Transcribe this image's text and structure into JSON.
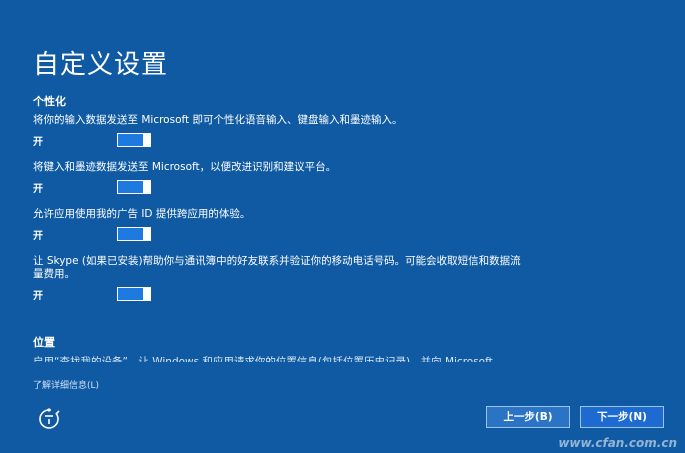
{
  "page": {
    "title": "自定义设置"
  },
  "personalization": {
    "header": "个性化",
    "settings": [
      {
        "description": "将你的输入数据发送至 Microsoft 即可个性化语音输入、键盘输入和墨迹输入。",
        "state": "开",
        "on": true
      },
      {
        "description": "将键入和墨迹数据发送至 Microsoft，以便改进识别和建议平台。",
        "state": "开",
        "on": true
      },
      {
        "description": "允许应用使用我的广告 ID 提供跨应用的体验。",
        "state": "开",
        "on": true
      },
      {
        "description": "让 Skype (如果已安装)帮助你与通讯簿中的好友联系并验证你的移动电话号码。可能会收取短信和数据流量费用。",
        "state": "开",
        "on": true
      }
    ]
  },
  "location": {
    "header": "位置",
    "partial_text": "启用“查找我的设备”，让 Windows 和应用请求你的位置信息(包括位置历史记录)，并向 Microsoft"
  },
  "footer": {
    "learn_more": "了解详细信息(L)",
    "back_button": "上一步(B)",
    "next_button": "下一步(N)",
    "ease_of_access_icon": "ease-of-access-icon"
  },
  "watermark": {
    "text": "www.cfan.com.cn"
  },
  "colors": {
    "background": "#0f5aa3",
    "toggle_on": "#1f7adf",
    "text": "#ffffff"
  }
}
